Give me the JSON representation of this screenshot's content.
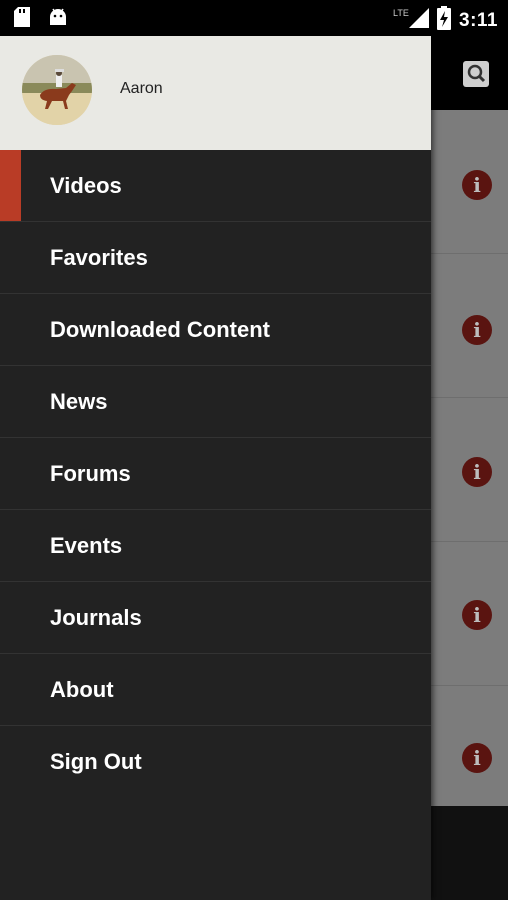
{
  "status_bar": {
    "time": "3:11",
    "network": "LTE",
    "icons": [
      "sd-card-icon",
      "android-icon",
      "signal-icon",
      "battery-charging-icon"
    ]
  },
  "app": {
    "toolbar_icon": "search-icon",
    "row_action_icon": "info-icon",
    "row_action_glyph": "i"
  },
  "drawer": {
    "user": {
      "name": "Aaron",
      "avatar": "avatar-rider-on-horse"
    },
    "items": [
      {
        "label": "Videos",
        "active": true
      },
      {
        "label": "Favorites"
      },
      {
        "label": "Downloaded Content"
      },
      {
        "label": "News"
      },
      {
        "label": "Forums"
      },
      {
        "label": "Events"
      },
      {
        "label": "Journals"
      },
      {
        "label": "About"
      },
      {
        "label": "Sign Out"
      }
    ],
    "accent_color": "#b93c26"
  }
}
